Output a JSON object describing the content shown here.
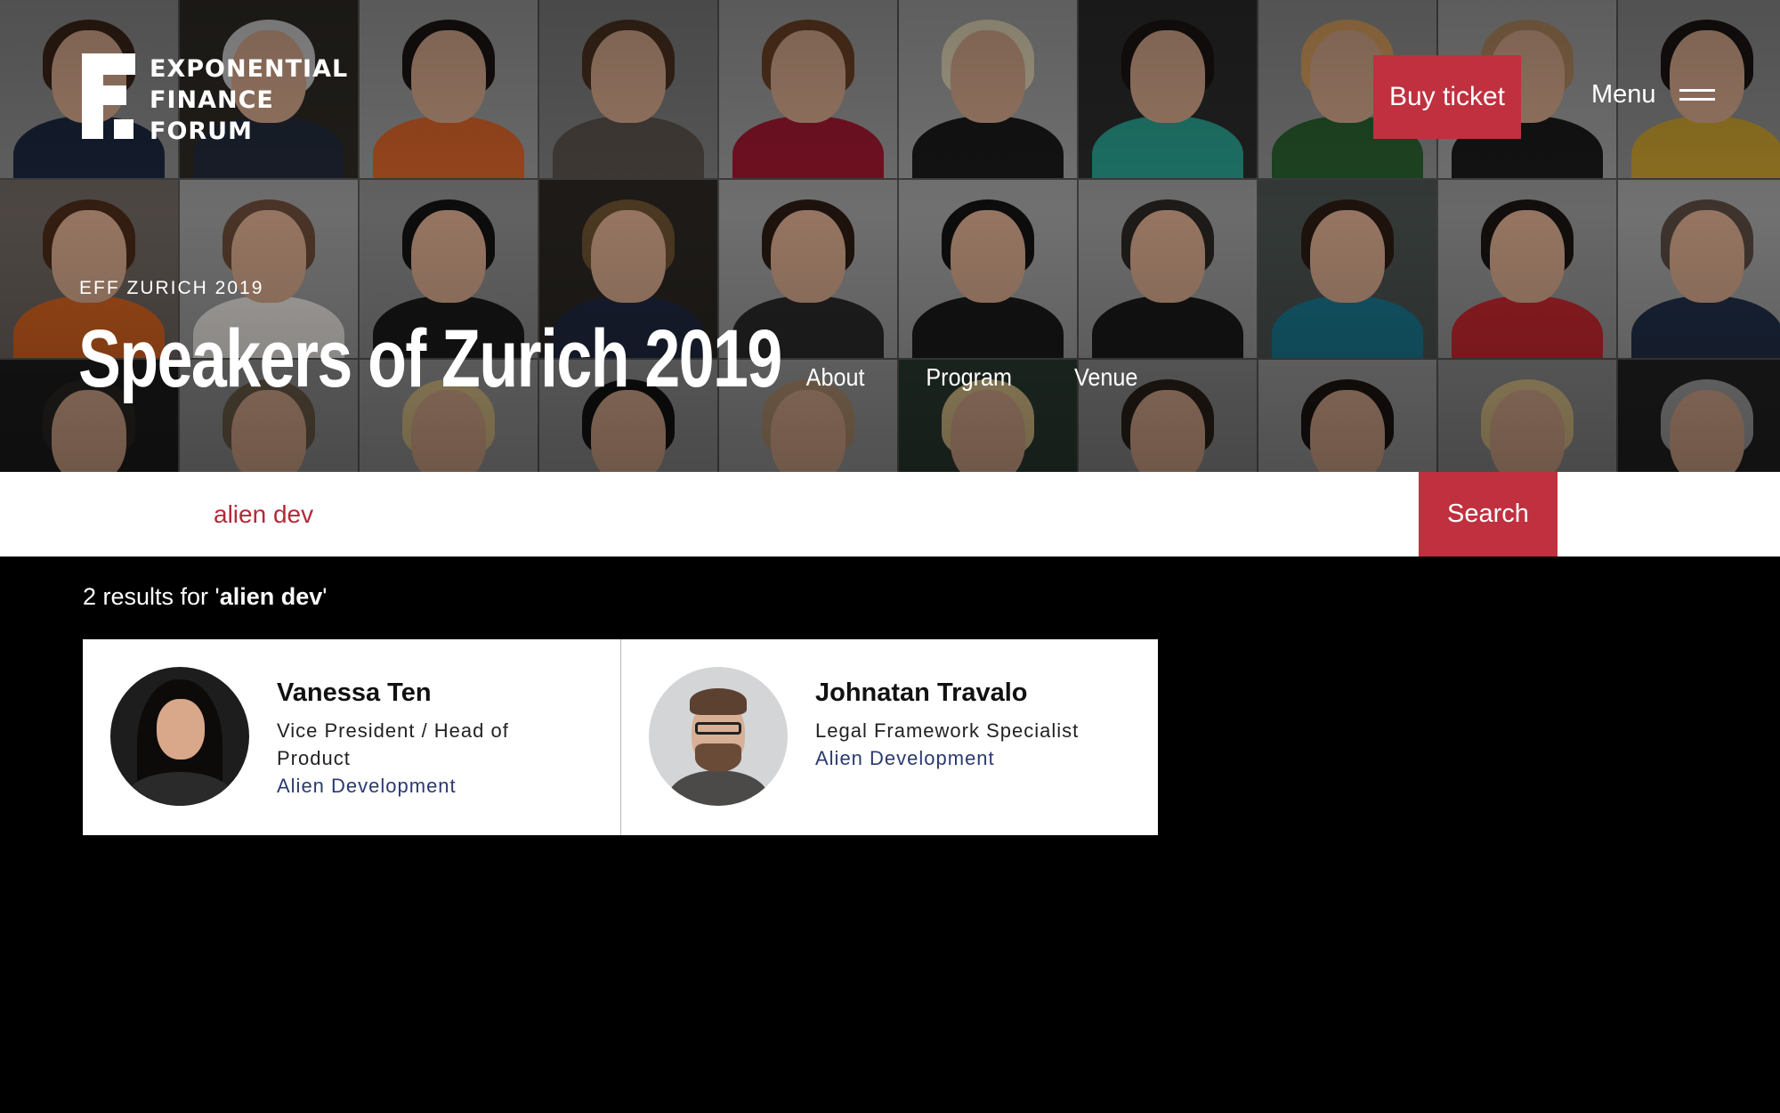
{
  "header": {
    "logo_lines": [
      "EXPONENTIAL",
      "FINANCE",
      "FORUM"
    ],
    "buy_ticket_label": "Buy ticket",
    "menu_label": "Menu"
  },
  "hero": {
    "eyebrow": "EFF ZURICH 2019",
    "title": "Speakers of Zurich 2019",
    "nav": [
      "About",
      "Program",
      "Venue"
    ]
  },
  "search": {
    "value": "alien dev",
    "button_label": "Search"
  },
  "results": {
    "count_prefix": "2 results for '",
    "query": "alien dev",
    "count_suffix": "'",
    "speakers": [
      {
        "name": "Vanessa Ten",
        "role": "Vice President / Head of Product",
        "company": "Alien Development"
      },
      {
        "name": "Johnatan Travalo",
        "role": "Legal Framework Specialist",
        "company": "Alien Development"
      }
    ]
  },
  "colors": {
    "accent": "#c0303f",
    "company_link": "#2a3a6e",
    "search_text": "#b22a3a"
  }
}
